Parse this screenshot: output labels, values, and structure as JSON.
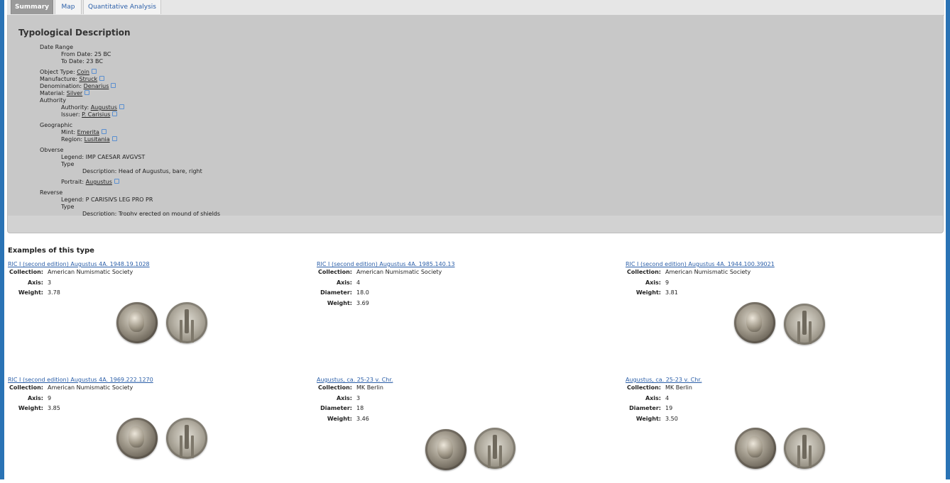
{
  "tabs": [
    {
      "label": "Summary",
      "active": true
    },
    {
      "label": "Map",
      "active": false
    },
    {
      "label": "Quantitative Analysis",
      "active": false
    }
  ],
  "summary": {
    "title": "Typological Description",
    "date_range": {
      "label": "Date Range",
      "from_label": "From Date:",
      "from_value": "25 BC",
      "to_label": "To Date:",
      "to_value": "23 BC"
    },
    "object_type": {
      "label": "Object Type:",
      "value": "Coin"
    },
    "manufacture": {
      "label": "Manufacture:",
      "value": "Struck"
    },
    "denomination": {
      "label": "Denomination:",
      "value": "Denarius"
    },
    "material": {
      "label": "Material:",
      "value": "Silver"
    },
    "authority_group": {
      "label": "Authority",
      "authority_label": "Authority:",
      "authority_value": "Augustus",
      "issuer_label": "Issuer:",
      "issuer_value": "P. Carisius"
    },
    "geographic": {
      "label": "Geographic",
      "mint_label": "Mint:",
      "mint_value": "Emerita",
      "region_label": "Region:",
      "region_value": "Lusitania"
    },
    "obverse": {
      "label": "Obverse",
      "legend_label": "Legend:",
      "legend_value": "IMP CAESAR AVGVST",
      "type_label": "Type",
      "description_label": "Description:",
      "description_value": "Head of Augustus, bare, right",
      "portrait_label": "Portrait:",
      "portrait_value": "Augustus"
    },
    "reverse": {
      "label": "Reverse",
      "legend_label": "Legend:",
      "legend_value": "P CARISIVS LEG PRO PR",
      "type_label": "Type",
      "description_label": "Description:",
      "description_value": "Trophy erected on mound of shields"
    }
  },
  "examples": {
    "title": "Examples of this type",
    "items": [
      {
        "link": "RIC I (second edition) Augustus 4A. 1948.19.1028",
        "rows": [
          {
            "label": "Collection:",
            "value": "American Numismatic Society"
          },
          {
            "label": "Axis:",
            "value": "3"
          },
          {
            "label": "Weight:",
            "value": "3.78"
          }
        ]
      },
      {
        "link": "RIC I (second edition) Augustus 4A. 1985.140.13",
        "rows": [
          {
            "label": "Collection:",
            "value": "American Numismatic Society"
          },
          {
            "label": "Axis:",
            "value": "4"
          },
          {
            "label": "Diameter:",
            "value": "18.0"
          },
          {
            "label": "Weight:",
            "value": "3.69"
          }
        ]
      },
      {
        "link": "RIC I (second edition) Augustus 4A. 1944.100.39021",
        "rows": [
          {
            "label": "Collection:",
            "value": "American Numismatic Society"
          },
          {
            "label": "Axis:",
            "value": "9"
          },
          {
            "label": "Weight:",
            "value": "3.81"
          }
        ]
      },
      {
        "link": "RIC I (second edition) Augustus 4A. 1969.222.1270",
        "rows": [
          {
            "label": "Collection:",
            "value": "American Numismatic Society"
          },
          {
            "label": "Axis:",
            "value": "9"
          },
          {
            "label": "Weight:",
            "value": "3.85"
          }
        ]
      },
      {
        "link": "Augustus, ca. 25-23 v. Chr.",
        "rows": [
          {
            "label": "Collection:",
            "value": "MK Berlin"
          },
          {
            "label": "Axis:",
            "value": "3"
          },
          {
            "label": "Diameter:",
            "value": "18"
          },
          {
            "label": "Weight:",
            "value": "3.46"
          }
        ]
      },
      {
        "link": "Augustus, ca. 25-23 v. Chr.",
        "rows": [
          {
            "label": "Collection:",
            "value": "MK Berlin"
          },
          {
            "label": "Axis:",
            "value": "4"
          },
          {
            "label": "Diameter:",
            "value": "19"
          },
          {
            "label": "Weight:",
            "value": "3.50"
          }
        ]
      }
    ]
  }
}
